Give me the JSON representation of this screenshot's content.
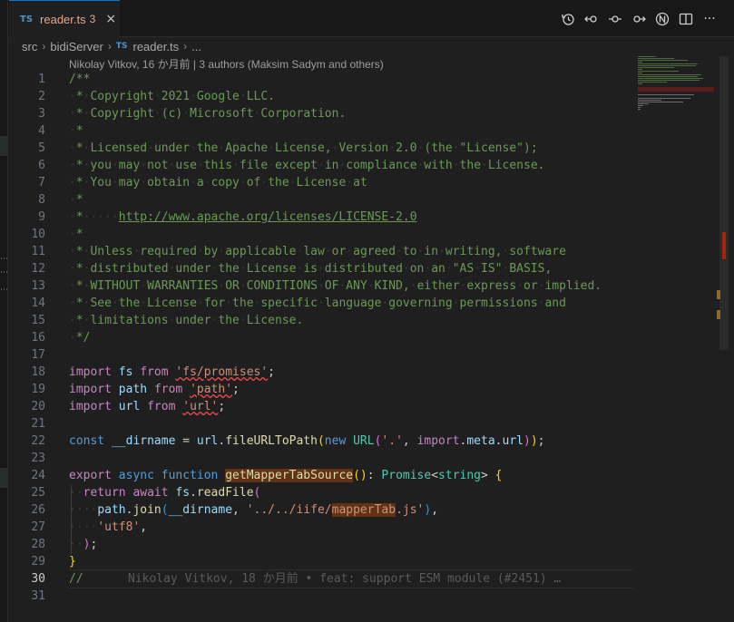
{
  "tab": {
    "badge": "TS",
    "filename": "reader.ts",
    "problem_count": "3",
    "close": "×"
  },
  "actions": [
    "history-icon",
    "git-compare-previous-icon",
    "git-commit-icon",
    "git-compare-next-icon",
    "copilot-icon",
    "split-editor-icon",
    "more-icon"
  ],
  "actions_more": "···",
  "breadcrumb": {
    "parts": [
      "src",
      "bidiServer"
    ],
    "ts_badge": "TS",
    "file": "reader.ts",
    "trail": "..."
  },
  "blame_header": "Nikolay Vitkov, 16 か月前 | 3 authors (Maksim Sadym and others)",
  "editor": {
    "active_line": 30,
    "lines": [
      {
        "n": "1",
        "t": "/**"
      },
      {
        "n": "2",
        "t": " * Copyright 2021 Google LLC."
      },
      {
        "n": "3",
        "t": " * Copyright (c) Microsoft Corporation."
      },
      {
        "n": "4",
        "t": " *"
      },
      {
        "n": "5",
        "t": " * Licensed under the Apache License, Version 2.0 (the \"License\");"
      },
      {
        "n": "6",
        "t": " * you may not use this file except in compliance with the License."
      },
      {
        "n": "7",
        "t": " * You may obtain a copy of the License at"
      },
      {
        "n": "8",
        "t": " *"
      },
      {
        "n": "9",
        "t": " *     http://www.apache.org/licenses/LICENSE-2.0"
      },
      {
        "n": "10",
        "t": " *"
      },
      {
        "n": "11",
        "t": " * Unless required by applicable law or agreed to in writing, software"
      },
      {
        "n": "12",
        "t": " * distributed under the License is distributed on an \"AS IS\" BASIS,"
      },
      {
        "n": "13",
        "t": " * WITHOUT WARRANTIES OR CONDITIONS OF ANY KIND, either express or implied."
      },
      {
        "n": "14",
        "t": " * See the License for the specific language governing permissions and"
      },
      {
        "n": "15",
        "t": " * limitations under the License."
      },
      {
        "n": "16",
        "t": " */"
      },
      {
        "n": "17",
        "t": ""
      },
      {
        "n": "18",
        "t": "import fs from 'fs/promises';"
      },
      {
        "n": "19",
        "t": "import path from 'path';"
      },
      {
        "n": "20",
        "t": "import url from 'url';"
      },
      {
        "n": "21",
        "t": ""
      },
      {
        "n": "22",
        "t": "const __dirname = url.fileURLToPath(new URL('.', import.meta.url));"
      },
      {
        "n": "23",
        "t": ""
      },
      {
        "n": "24",
        "t": "export async function getMapperTabSource(): Promise<string> {"
      },
      {
        "n": "25",
        "t": "  return await fs.readFile("
      },
      {
        "n": "26",
        "t": "    path.join(__dirname, '../../iife/mapperTab.js'),"
      },
      {
        "n": "27",
        "t": "    'utf8',"
      },
      {
        "n": "28",
        "t": "  );"
      },
      {
        "n": "29",
        "t": "}"
      },
      {
        "n": "30",
        "t": "//"
      },
      {
        "n": "31",
        "t": ""
      }
    ],
    "inline_blame": "Nikolay Vitkov, 18 か月前 • feat: support ESM module (#2451) …"
  },
  "colors": {
    "accent": "#0078d4",
    "tab_error_text": "#e5a88c",
    "error_squiggle": "#f14c4c",
    "highlight": "#613214"
  }
}
